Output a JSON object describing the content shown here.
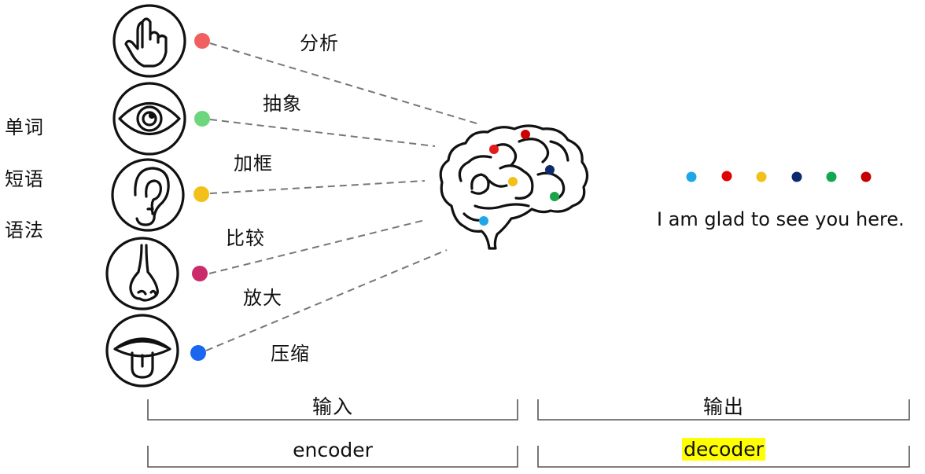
{
  "left_labels": [
    "单词",
    "短语",
    "语法"
  ],
  "senses": [
    {
      "icon": "hand-pointer-icon",
      "color": "#f06060",
      "action": "分析"
    },
    {
      "icon": "eye-icon",
      "color": "#6dd67d",
      "action": "抽象"
    },
    {
      "icon": "ear-icon",
      "color": "#f2c018",
      "action": "加框"
    },
    {
      "icon": "nose-icon",
      "color": "#cc2b6b",
      "action": "比较"
    },
    {
      "icon": "mouth-tongue-icon",
      "color": "#1a66f0",
      "action": "放大"
    }
  ],
  "extra_action": "压缩",
  "brain": {
    "icon": "brain-icon",
    "dot_colors": [
      "#e21b1b",
      "#cc0000",
      "#0d2a6e",
      "#f2c018",
      "#1aa34a",
      "#1ea7e6"
    ]
  },
  "output_dots": [
    "#1ea7e6",
    "#e00000",
    "#f2c018",
    "#0d2a6e",
    "#12a850",
    "#c40000"
  ],
  "output_sentence": "I am glad to see you here.",
  "brackets": {
    "input_label": "输入",
    "output_label": "输出",
    "encoder_label": "encoder",
    "decoder_label": "decoder",
    "highlight_color": "#ffff00"
  }
}
